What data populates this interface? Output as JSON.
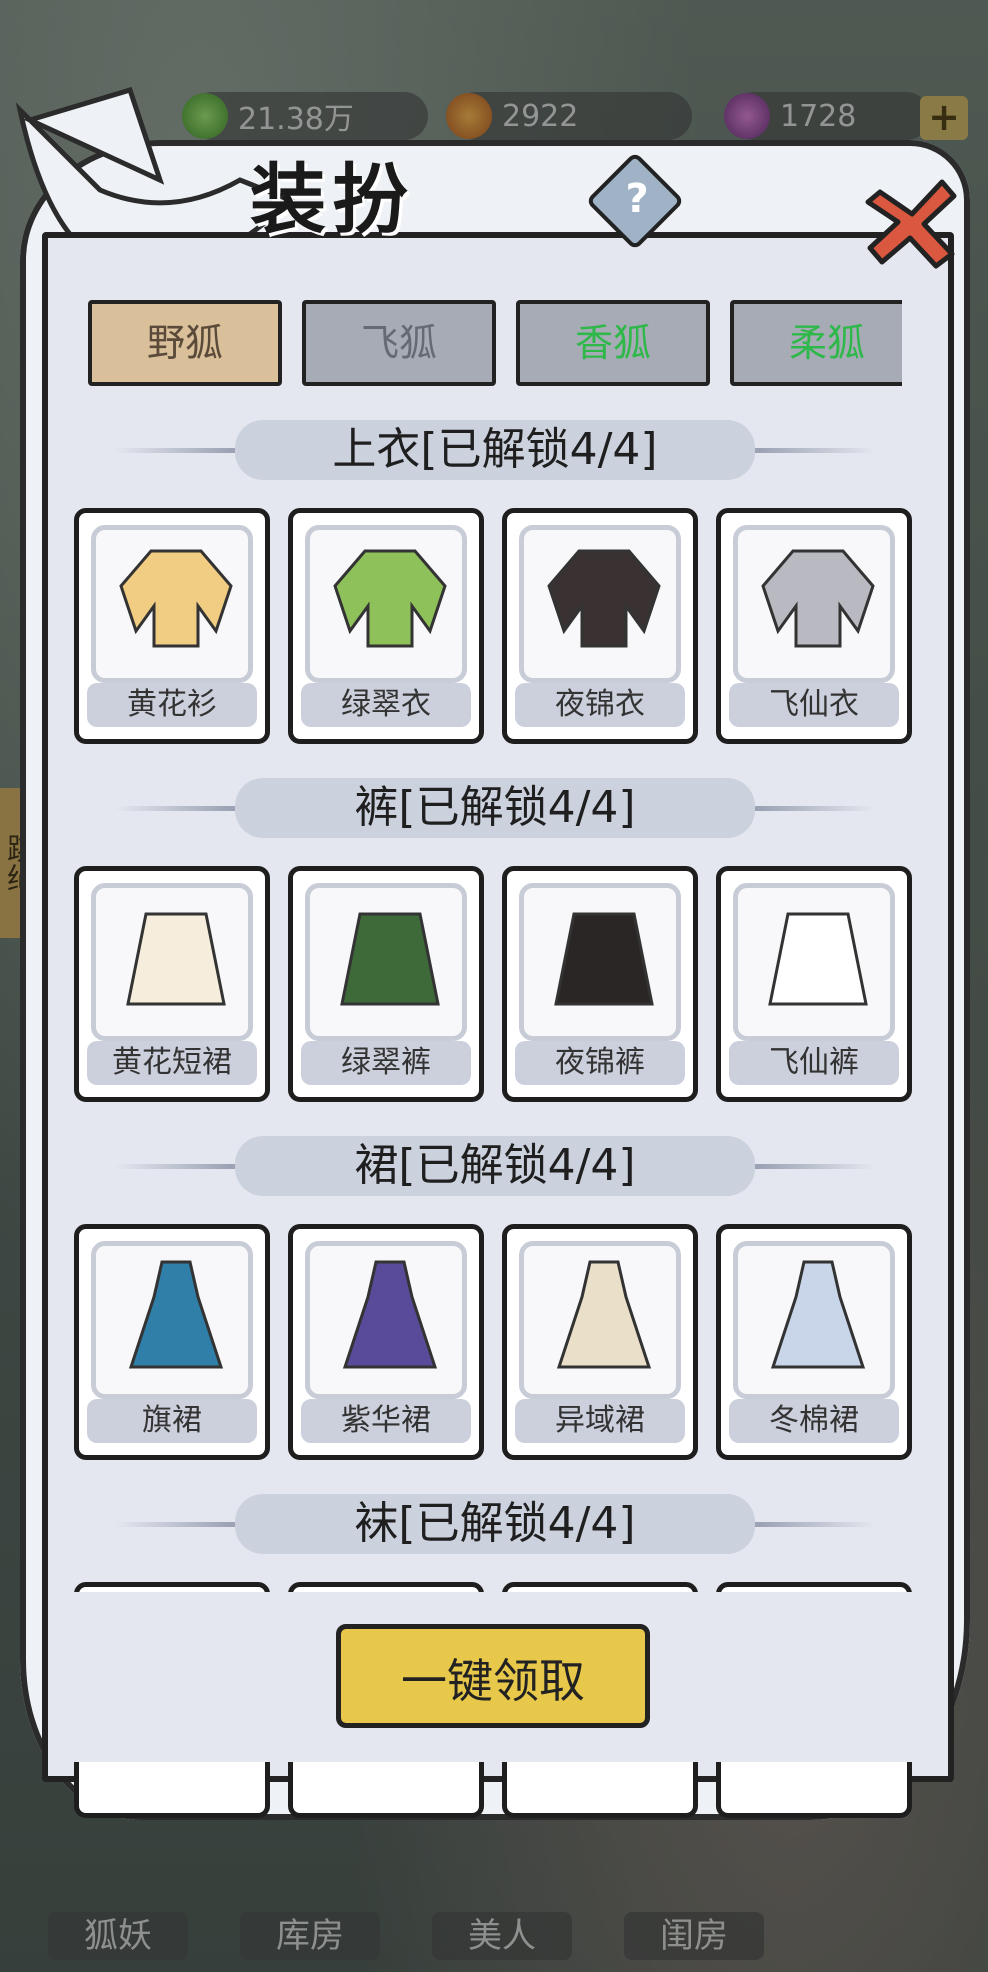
{
  "title": "装扮",
  "help_label": "?",
  "resources": [
    {
      "icon": "green-flame-icon",
      "value": "21.38万"
    },
    {
      "icon": "orange-coin-icon",
      "value": "2922"
    },
    {
      "icon": "purple-gem-icon",
      "value": "1728"
    }
  ],
  "plus_label": "+",
  "tabs": [
    {
      "label": "野狐",
      "color": "#d9c09a",
      "text_color": "#5a4a3a",
      "selected": true
    },
    {
      "label": "飞狐",
      "color": "#a7abb6",
      "text_color": "#666a74",
      "selected": false
    },
    {
      "label": "香狐",
      "color": "#a7abb6",
      "text_color": "#2fb84a",
      "selected": false
    },
    {
      "label": "柔狐",
      "color": "#a7abb6",
      "text_color": "#2fb84a",
      "selected": false
    }
  ],
  "sections": [
    {
      "title": "上衣[已解锁4/4]",
      "items": [
        {
          "name": "黄花衫",
          "icon": "yellow-top-icon",
          "color": "#f1cd84"
        },
        {
          "name": "绿翠衣",
          "icon": "green-top-icon",
          "color": "#8fc15a"
        },
        {
          "name": "夜锦衣",
          "icon": "night-top-icon",
          "color": "#3a3232"
        },
        {
          "name": "飞仙衣",
          "icon": "fairy-top-icon",
          "color": "#b9b9c2"
        }
      ]
    },
    {
      "title": "裤[已解锁4/4]",
      "items": [
        {
          "name": "黄花短裙",
          "icon": "yellow-skirt-icon",
          "color": "#f6eddc"
        },
        {
          "name": "绿翠裤",
          "icon": "green-pants-icon",
          "color": "#3e6a3a"
        },
        {
          "name": "夜锦裤",
          "icon": "night-skirt-icon",
          "color": "#2b2626"
        },
        {
          "name": "飞仙裤",
          "icon": "fairy-pants-icon",
          "color": "#ffffff"
        }
      ]
    },
    {
      "title": "裙[已解锁4/4]",
      "items": [
        {
          "name": "旗裙",
          "icon": "qipao-icon",
          "color": "#2f7fa8"
        },
        {
          "name": "紫华裙",
          "icon": "purple-dress-icon",
          "color": "#5a4b9a"
        },
        {
          "name": "异域裙",
          "icon": "exotic-dress-icon",
          "color": "#eadfc8"
        },
        {
          "name": "冬棉裙",
          "icon": "winter-dress-icon",
          "color": "#c9d6ea"
        }
      ]
    },
    {
      "title": "袜[已解锁4/4]",
      "items": []
    }
  ],
  "claim_label": "一键领取",
  "bottom_tabs": [
    "狐妖",
    "库房",
    "美人",
    "闺房"
  ],
  "side_label": "跳绳"
}
